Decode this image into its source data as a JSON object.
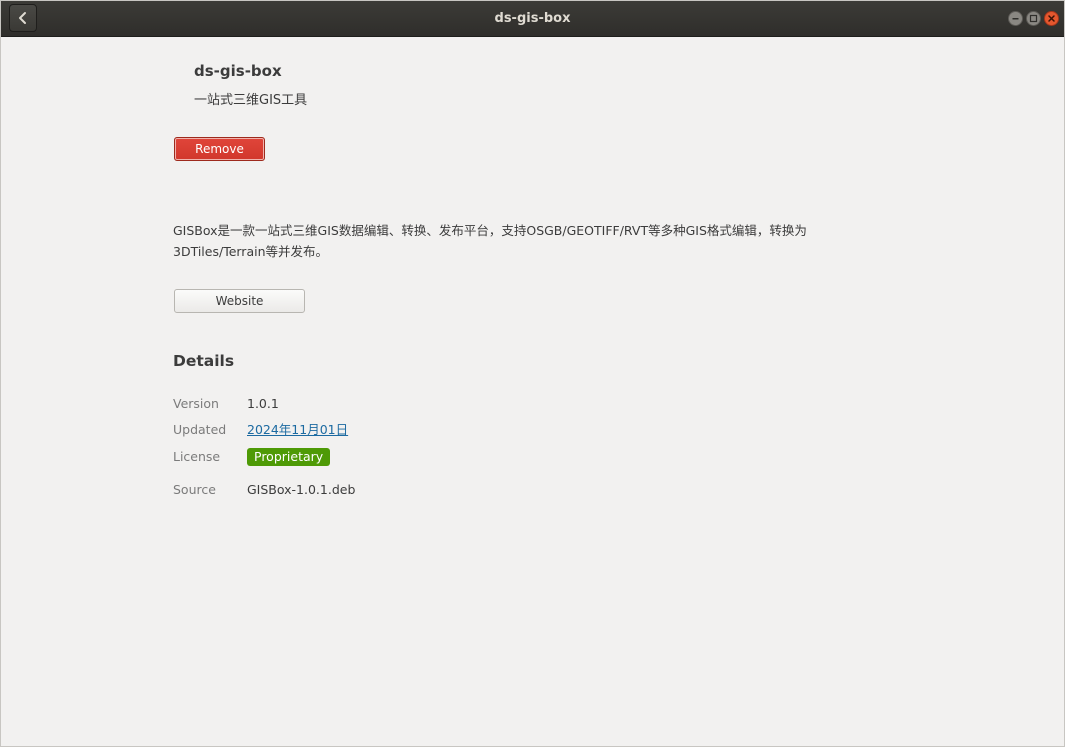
{
  "window": {
    "title": "ds-gis-box"
  },
  "app": {
    "name": "ds-gis-box",
    "summary": "一站式三维GIS工具",
    "remove_label": "Remove",
    "description": "GISBox是一款一站式三维GIS数据编辑、转换、发布平台，支持OSGB/GEOTIFF/RVT等多种GIS格式编辑，转换为3DTiles/Terrain等并发布。",
    "website_label": "Website"
  },
  "details": {
    "heading": "Details",
    "rows": [
      {
        "label": "Version",
        "value": "1.0.1"
      },
      {
        "label": "Updated",
        "value": "2024年11月01日"
      },
      {
        "label": "License",
        "value": "Proprietary"
      },
      {
        "label": "Source",
        "value": "GISBox-1.0.1.deb"
      }
    ]
  },
  "colors": {
    "remove": "#e0453a",
    "license_badge": "#4e9a06",
    "link": "#1c6aa1",
    "close": "#e4572e"
  },
  "icons": {
    "back": "chevron-left-icon",
    "minimize": "minimize-icon",
    "maximize": "maximize-icon",
    "close": "close-icon"
  }
}
